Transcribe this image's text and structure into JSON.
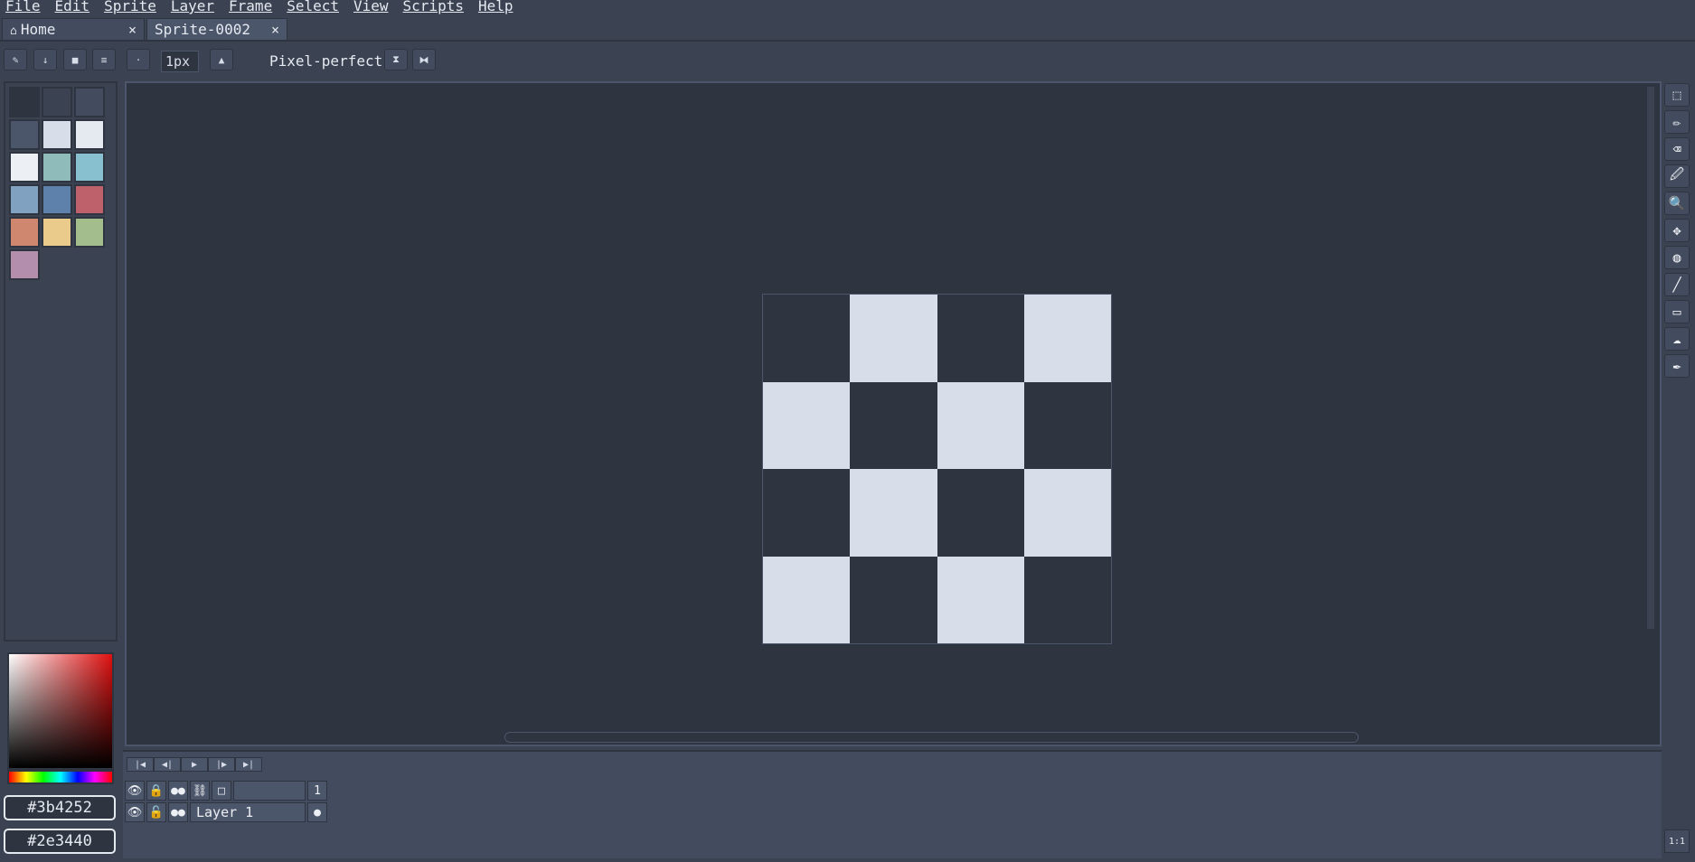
{
  "menu": [
    "File",
    "Edit",
    "Sprite",
    "Layer",
    "Frame",
    "Select",
    "View",
    "Scripts",
    "Help"
  ],
  "tabs": {
    "home_label": "Home",
    "sprite_label": "Sprite-0002",
    "close_glyph": "×"
  },
  "toolbar": {
    "brush_size": "1px",
    "pixel_perfect_label": "Pixel-perfect"
  },
  "palette": {
    "swatches": [
      "#2e3440",
      "#3b4252",
      "#434c5e",
      "#4c566a",
      "#d8dee9",
      "#e5e9f0",
      "#eceff4",
      "#8fbcbb",
      "#88c0d0",
      "#81a1c1",
      "#5e81ac",
      "#bf616a",
      "#d08770",
      "#ebcb8b",
      "#a3be8c",
      "#b48ead"
    ]
  },
  "colors": {
    "foreground_hex": "#3b4252",
    "background_hex": "#2e3440",
    "accent_light": "#d8dee9",
    "canvas_bg": "#2e3440"
  },
  "sprite": {
    "pattern": [
      [
        0,
        1,
        0,
        1
      ],
      [
        1,
        0,
        1,
        0
      ],
      [
        0,
        1,
        0,
        1
      ],
      [
        1,
        0,
        1,
        0
      ]
    ]
  },
  "tools": [
    "rectangular-marquee-icon",
    "pencil-icon",
    "eraser-icon",
    "eyedropper-icon",
    "zoom-icon",
    "move-icon",
    "paint-bucket-icon",
    "line-icon",
    "rectangle-icon",
    "blur-icon",
    "ink-icon"
  ],
  "timeline": {
    "frame_number": "1",
    "layer_name": "Layer 1"
  },
  "zoom_label": "1:1"
}
